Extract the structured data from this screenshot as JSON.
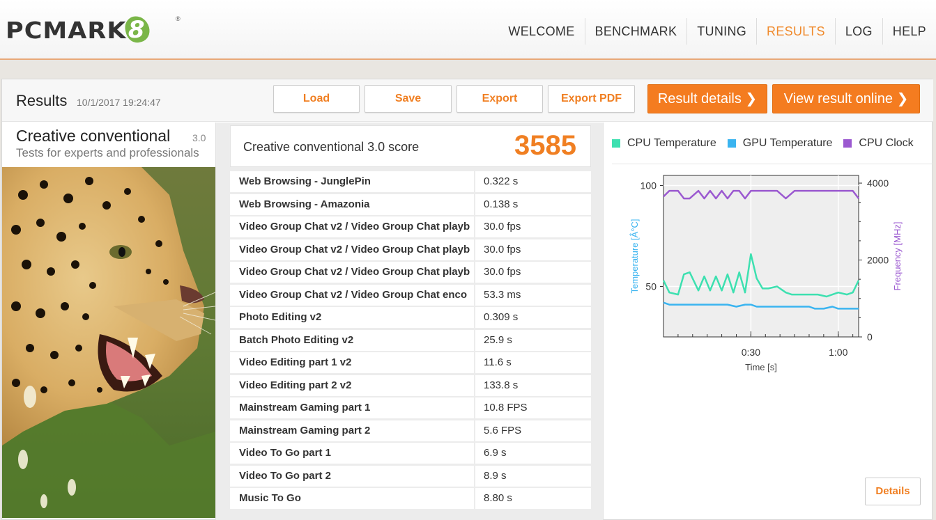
{
  "app": {
    "logo_text": "PCMARK",
    "logo_version": "8",
    "logo_tm": "®"
  },
  "nav": {
    "items": [
      {
        "label": "WELCOME"
      },
      {
        "label": "BENCHMARK"
      },
      {
        "label": "TUNING"
      },
      {
        "label": "RESULTS"
      },
      {
        "label": "LOG"
      },
      {
        "label": "HELP"
      }
    ],
    "active": "RESULTS"
  },
  "header": {
    "title": "Results",
    "date": "10/1/2017 19:24:47",
    "buttons": {
      "load": "Load",
      "save": "Save",
      "export": "Export",
      "export_pdf": "Export PDF",
      "result_details": "Result details ❯",
      "view_online": "View result online ❯"
    }
  },
  "test": {
    "name": "Creative conventional",
    "version": "3.0",
    "subtitle": "Tests for experts and professionals"
  },
  "score": {
    "label": "Creative conventional 3.0 score",
    "value": "3585"
  },
  "results": [
    {
      "name": "Web Browsing - JunglePin",
      "value": "0.322 s"
    },
    {
      "name": "Web Browsing - Amazonia",
      "value": "0.138 s"
    },
    {
      "name": "Video Group Chat v2 / Video Group Chat playb",
      "value": "30.0 fps"
    },
    {
      "name": "Video Group Chat v2 / Video Group Chat playb",
      "value": "30.0 fps"
    },
    {
      "name": "Video Group Chat v2 / Video Group Chat playb",
      "value": "30.0 fps"
    },
    {
      "name": "Video Group Chat v2 / Video Group Chat enco",
      "value": "53.3 ms"
    },
    {
      "name": "Photo Editing v2",
      "value": "0.309 s"
    },
    {
      "name": "Batch Photo Editing v2",
      "value": "25.9 s"
    },
    {
      "name": "Video Editing part 1 v2",
      "value": "11.6 s"
    },
    {
      "name": "Video Editing part 2 v2",
      "value": "133.8 s"
    },
    {
      "name": "Mainstream Gaming part 1",
      "value": "10.8 FPS"
    },
    {
      "name": "Mainstream Gaming part 2",
      "value": "5.6 FPS"
    },
    {
      "name": "Video To Go part 1",
      "value": "6.9 s"
    },
    {
      "name": "Video To Go part 2",
      "value": "8.9 s"
    },
    {
      "name": "Music To Go",
      "value": "8.80 s"
    }
  ],
  "monitor": {
    "details_label": "Details",
    "colors": {
      "cpu_temp": "#3de0b0",
      "gpu_temp": "#3ab4f0",
      "cpu_clock": "#9b59d0"
    }
  },
  "chart_data": {
    "type": "line",
    "legend": [
      "CPU Temperature",
      "GPU Temperature",
      "CPU Clock"
    ],
    "xlabel": "Time [s]",
    "ylabel_left": "Temperature [Â°C]",
    "ylabel_right": "Frequency [MHz]",
    "x_ticks": [
      "0:30",
      "1:00"
    ],
    "y_left_ticks": [
      "100",
      "50"
    ],
    "y_right_ticks": [
      "4000",
      "2000",
      "0"
    ],
    "xlim": [
      0,
      67
    ],
    "ylim_left": [
      25,
      105
    ],
    "ylim_right": [
      0,
      4200
    ],
    "series": [
      {
        "name": "CPU Temperature",
        "axis": "left",
        "x": [
          0,
          2,
          5,
          7,
          9,
          12,
          14,
          16,
          18,
          20,
          22,
          24,
          26,
          28,
          30,
          32,
          34,
          36,
          39,
          42,
          44,
          47,
          50,
          53,
          56,
          58,
          60,
          63,
          65,
          67
        ],
        "y": [
          53,
          47,
          46,
          56,
          57,
          48,
          55,
          48,
          55,
          48,
          56,
          47,
          57,
          47,
          66,
          54,
          49,
          49,
          50,
          47,
          46,
          46,
          46,
          46,
          45,
          46,
          47,
          46,
          47,
          53
        ]
      },
      {
        "name": "GPU Temperature",
        "axis": "left",
        "x": [
          0,
          2,
          8,
          15,
          22,
          25,
          28,
          30,
          32,
          35,
          40,
          45,
          50,
          52,
          55,
          58,
          60,
          67
        ],
        "y": [
          42,
          41,
          41,
          41,
          41,
          40,
          41,
          41,
          40,
          40,
          40,
          40,
          40,
          39,
          39,
          40,
          39,
          39
        ]
      },
      {
        "name": "CPU Clock",
        "axis": "right",
        "x": [
          0,
          2,
          5,
          7,
          9,
          12,
          14,
          16,
          18,
          20,
          22,
          24,
          26,
          28,
          30,
          33,
          36,
          39,
          42,
          45,
          47,
          50,
          53,
          56,
          60,
          63,
          65,
          67
        ],
        "y": [
          3650,
          3800,
          3800,
          3600,
          3600,
          3800,
          3600,
          3800,
          3600,
          3800,
          3600,
          3800,
          3800,
          3600,
          3800,
          3800,
          3800,
          3800,
          3600,
          3800,
          3800,
          3800,
          3800,
          3800,
          3800,
          3800,
          3800,
          3600
        ]
      }
    ],
    "grid": true
  }
}
